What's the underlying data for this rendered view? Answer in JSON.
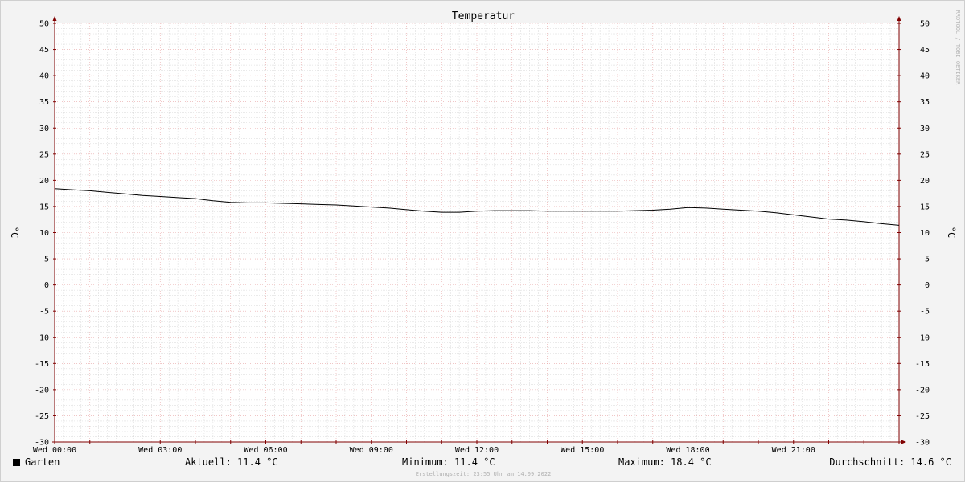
{
  "chart_data": {
    "type": "line",
    "title": "Temperatur",
    "ylabel": "°C",
    "ylabel_right": "°C",
    "ylim": [
      -30,
      50
    ],
    "yticks": [
      50,
      45,
      40,
      35,
      30,
      25,
      20,
      15,
      10,
      5,
      0,
      -5,
      -10,
      -15,
      -20,
      -25,
      -30
    ],
    "xlim": [
      0,
      24
    ],
    "xticks": [
      {
        "hour": 0,
        "label": "Wed 00:00"
      },
      {
        "hour": 3,
        "label": "Wed 03:00"
      },
      {
        "hour": 6,
        "label": "Wed 06:00"
      },
      {
        "hour": 9,
        "label": "Wed 09:00"
      },
      {
        "hour": 12,
        "label": "Wed 12:00"
      },
      {
        "hour": 15,
        "label": "Wed 15:00"
      },
      {
        "hour": 18,
        "label": "Wed 18:00"
      },
      {
        "hour": 21,
        "label": "Wed 21:00"
      }
    ],
    "grid": true,
    "series": [
      {
        "name": "Garten",
        "color": "#000000",
        "x": [
          0,
          0.5,
          1,
          1.5,
          2,
          2.5,
          3,
          3.5,
          4,
          4.5,
          5,
          5.5,
          6,
          6.5,
          7,
          7.5,
          8,
          8.5,
          9,
          9.5,
          10,
          10.5,
          11,
          11.5,
          12,
          12.5,
          13,
          13.5,
          14,
          14.5,
          15,
          15.5,
          16,
          16.5,
          17,
          17.5,
          18,
          18.5,
          19,
          19.5,
          20,
          20.5,
          21,
          21.5,
          22,
          22.5,
          23,
          23.5,
          24
        ],
        "values": [
          18.4,
          18.2,
          18.0,
          17.7,
          17.4,
          17.1,
          16.9,
          16.7,
          16.5,
          16.1,
          15.8,
          15.7,
          15.7,
          15.6,
          15.5,
          15.4,
          15.3,
          15.1,
          14.9,
          14.7,
          14.4,
          14.1,
          13.9,
          13.9,
          14.1,
          14.2,
          14.2,
          14.2,
          14.1,
          14.1,
          14.1,
          14.1,
          14.1,
          14.2,
          14.3,
          14.5,
          14.8,
          14.7,
          14.5,
          14.3,
          14.1,
          13.8,
          13.4,
          13.0,
          12.6,
          12.4,
          12.1,
          11.7,
          11.4
        ]
      }
    ],
    "legend": {
      "series_label": "Garten",
      "aktuell": "Aktuell: 11.4 °C",
      "minimum": "Minimum: 11.4 °C",
      "maximum": "Maximum: 18.4 °C",
      "durchschnitt": "Durchschnitt: 14.6 °C"
    },
    "watermark": "RRDTOOL / TOBI OETIKER",
    "footer": "Erstellungszeit: 23:55 Uhr am 14.09.2022",
    "colors": {
      "background": "#f3f3f3",
      "plot_background": "#ffffff",
      "minor_grid": "#d6d6d6",
      "major_grid": "#e8a5a5",
      "axis": "#800000"
    }
  }
}
